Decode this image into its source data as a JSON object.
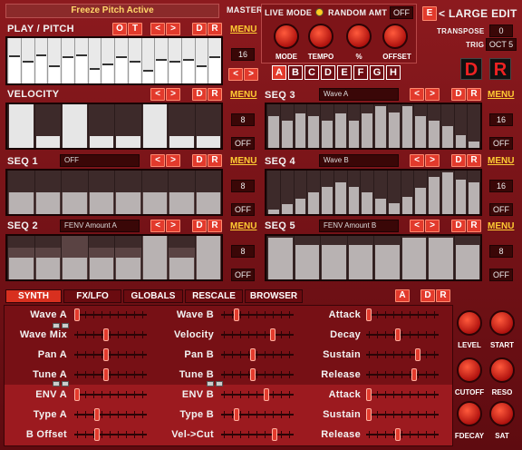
{
  "header": {
    "status": "Freeze Pitch Active",
    "master_label": "MASTER"
  },
  "play_pitch": {
    "title": "PLAY / PITCH",
    "btn_o": "O",
    "btn_t": "T",
    "menu": "MENU",
    "steps": "16",
    "pitch_heights": [
      0.62,
      0.5,
      0.65,
      0.4,
      0.6,
      0.65,
      0.35,
      0.45,
      0.6,
      0.5,
      0.3,
      0.55,
      0.5,
      0.55,
      0.4,
      0.6
    ]
  },
  "common": {
    "prev": "<",
    "next": ">",
    "d": "D",
    "r": "R",
    "menu": "MENU",
    "off": "OFF"
  },
  "velocity": {
    "title": "VELOCITY",
    "steps": "8",
    "off": "OFF",
    "values": [
      1.0,
      0.28,
      1.0,
      0.28,
      0.28,
      1.0,
      0.28,
      0.28
    ],
    "dark": [
      1,
      1,
      1,
      1,
      1,
      1,
      1,
      1
    ]
  },
  "seq1": {
    "title": "SEQ 1",
    "field": "OFF",
    "steps": "8",
    "off": "OFF",
    "values": [
      0.5,
      0.5,
      0.5,
      0.5,
      0.5,
      0.5,
      0.5,
      0.5
    ],
    "under": [
      0.5,
      0.5,
      0.5,
      0.5,
      0.5,
      0.5,
      0.5,
      0.5
    ]
  },
  "seq2": {
    "title": "SEQ 2",
    "field": "FENV Amount A",
    "steps": "8",
    "off": "OFF",
    "values": [
      0.5,
      0.5,
      0.5,
      0.5,
      0.5,
      1.0,
      0.5,
      1.0
    ],
    "under": [
      0.72,
      0.72,
      1.0,
      0.72,
      0.72,
      1.0,
      0.72,
      1.0
    ]
  },
  "seq3": {
    "title": "SEQ 3",
    "field": "Wave A",
    "steps": "16",
    "off": "OFF",
    "values": [
      0.72,
      0.62,
      0.8,
      0.72,
      0.62,
      0.8,
      0.62,
      0.8,
      0.95,
      0.82,
      0.95,
      0.72,
      0.62,
      0.5,
      0.3,
      0.15
    ]
  },
  "seq4": {
    "title": "SEQ 4",
    "field": "Wave B",
    "steps": "16",
    "off": "OFF",
    "values": [
      0.1,
      0.22,
      0.35,
      0.5,
      0.62,
      0.72,
      0.62,
      0.5,
      0.35,
      0.25,
      0.4,
      0.6,
      0.85,
      0.95,
      0.8,
      0.72
    ]
  },
  "seq5": {
    "title": "SEQ 5",
    "field": "FENV Amount B",
    "steps": "8",
    "off": "OFF",
    "values": [
      0.95,
      0.8,
      0.8,
      0.8,
      0.8,
      0.95,
      0.95,
      0.8
    ]
  },
  "live": {
    "live_mode": "LIVE MODE",
    "random_amt": "RANDOM AMT",
    "random_value": "OFF",
    "knobs": [
      "MODE",
      "TEMPO",
      "%",
      "OFFSET"
    ],
    "seq_letters": [
      "A",
      "B",
      "C",
      "D",
      "E",
      "F",
      "G",
      "H"
    ]
  },
  "large_edit": {
    "e_btn": "E",
    "label": "< LARGE EDIT",
    "transpose_label": "TRANSPOSE",
    "transpose_value": "0",
    "trig_label": "TRIG",
    "trig_value": "OCT 5",
    "d_big": "D",
    "r_big": "R"
  },
  "tabs": {
    "synth": "SYNTH",
    "fxlfo": "FX/LFO",
    "globals": "GLOBALS",
    "rescale": "RESCALE",
    "browser": "BROWSER",
    "a": "A",
    "d": "D",
    "r": "R"
  },
  "synth": {
    "col1": [
      "Wave A",
      "Wave Mix",
      "Pan A",
      "Tune A",
      "ENV A",
      "Type A",
      "B Offset"
    ],
    "col2": [
      "Wave B",
      "Velocity",
      "Pan B",
      "Tune B",
      "ENV B",
      "Type B",
      "Vel->Cut"
    ],
    "col3": [
      "Attack",
      "Decay",
      "Sustain",
      "Release",
      "Attack",
      "Sustain",
      "Release"
    ],
    "col1_pos": [
      0.0,
      0.45,
      0.45,
      0.45,
      0.0,
      0.3,
      0.3
    ],
    "col2_pos": [
      0.2,
      0.75,
      0.45,
      0.45,
      0.65,
      0.2,
      0.78
    ],
    "col3_pos": [
      0.0,
      0.45,
      0.75,
      0.7,
      0.0,
      0.0,
      0.45
    ],
    "knobs": [
      "LEVEL",
      "START",
      "CUTOFF",
      "RESO",
      "FDECAY",
      "SAT"
    ]
  }
}
